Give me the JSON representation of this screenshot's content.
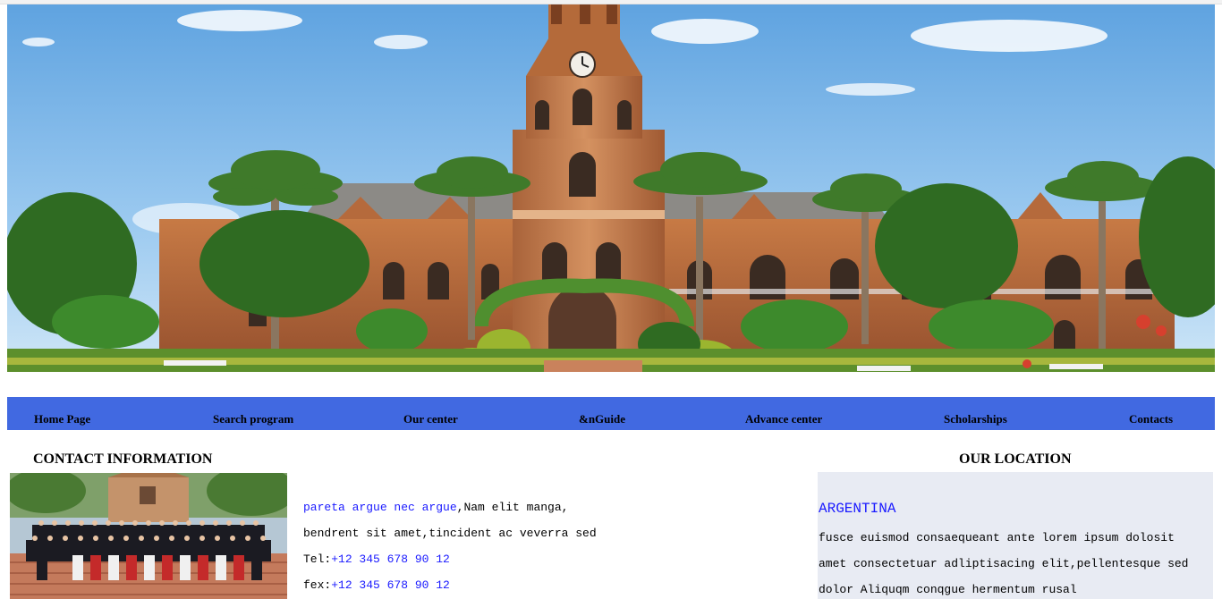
{
  "nav": {
    "items": [
      {
        "label": "Home Page"
      },
      {
        "label": "Search program"
      },
      {
        "label": "Our center"
      },
      {
        "label": "&nGuide"
      },
      {
        "label": "Advance center"
      },
      {
        "label": "Scholarships"
      },
      {
        "label": "Contacts"
      }
    ]
  },
  "contact": {
    "heading": "CONTACT INFORMATION",
    "line1_link": "pareta argue nec argue",
    "line1_rest": ",Nam elit manga,",
    "line2": "bendrent sit amet,tincident ac veverra sed",
    "tel_label": "Tel:",
    "tel_value": "+12 345 678 90 12",
    "fax_label": "fex:",
    "fax_value": "+12 345 678 90 12"
  },
  "location": {
    "heading": "OUR LOCATION",
    "country": "ARGENTINA",
    "line1": "fusce euismod consaequeant ante lorem ipsum dolosit",
    "line2": " amet consectetuar adliptisacing elit,pellentesque sed",
    "line3": "dolor Aliquqm conqgue hermentum rusal"
  },
  "colors": {
    "nav_bg": "#4169e1",
    "link_blue": "#1a1aff",
    "location_bg": "#e8ebf3"
  },
  "images": {
    "hero": "university-building-illustration",
    "group": "group-photo-illustration"
  }
}
